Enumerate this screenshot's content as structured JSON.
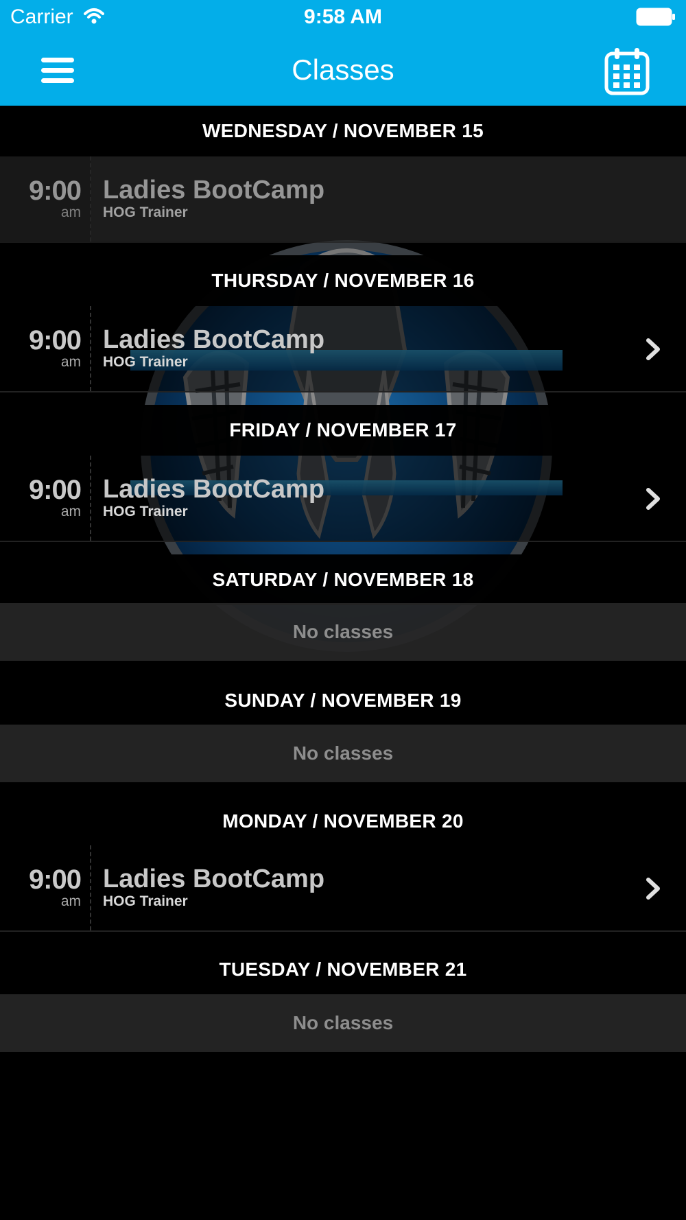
{
  "status_bar": {
    "carrier": "Carrier",
    "time": "9:58 AM",
    "wifi_icon": "wifi-icon",
    "battery_icon": "battery-icon"
  },
  "nav": {
    "title": "Classes",
    "menu_icon": "hamburger-menu-icon",
    "calendar_icon": "calendar-icon"
  },
  "colors": {
    "nav_bar": "#03aee9",
    "background": "#000000",
    "row_dark": "#262626",
    "no_classes_text": "#8d8d8d"
  },
  "days": [
    {
      "header": "WEDNESDAY / NOVEMBER 15",
      "classes": [
        {
          "time": "9:00",
          "ampm": "am",
          "name": "Ladies BootCamp",
          "trainer": "HOG Trainer",
          "past": true
        }
      ]
    },
    {
      "header": "THURSDAY / NOVEMBER 16",
      "classes": [
        {
          "time": "9:00",
          "ampm": "am",
          "name": "Ladies BootCamp",
          "trainer": "HOG Trainer",
          "past": false
        }
      ]
    },
    {
      "header": "FRIDAY / NOVEMBER 17",
      "classes": [
        {
          "time": "9:00",
          "ampm": "am",
          "name": "Ladies BootCamp",
          "trainer": "HOG Trainer",
          "past": false
        }
      ]
    },
    {
      "header": "SATURDAY / NOVEMBER 18",
      "empty_text": "No classes"
    },
    {
      "header": "SUNDAY / NOVEMBER 19",
      "empty_text": "No classes"
    },
    {
      "header": "MONDAY / NOVEMBER 20",
      "classes": [
        {
          "time": "9:00",
          "ampm": "am",
          "name": "Ladies BootCamp",
          "trainer": "HOG Trainer",
          "past": false
        }
      ]
    },
    {
      "header": "TUESDAY / NOVEMBER 21",
      "empty_text": "No classes"
    }
  ]
}
